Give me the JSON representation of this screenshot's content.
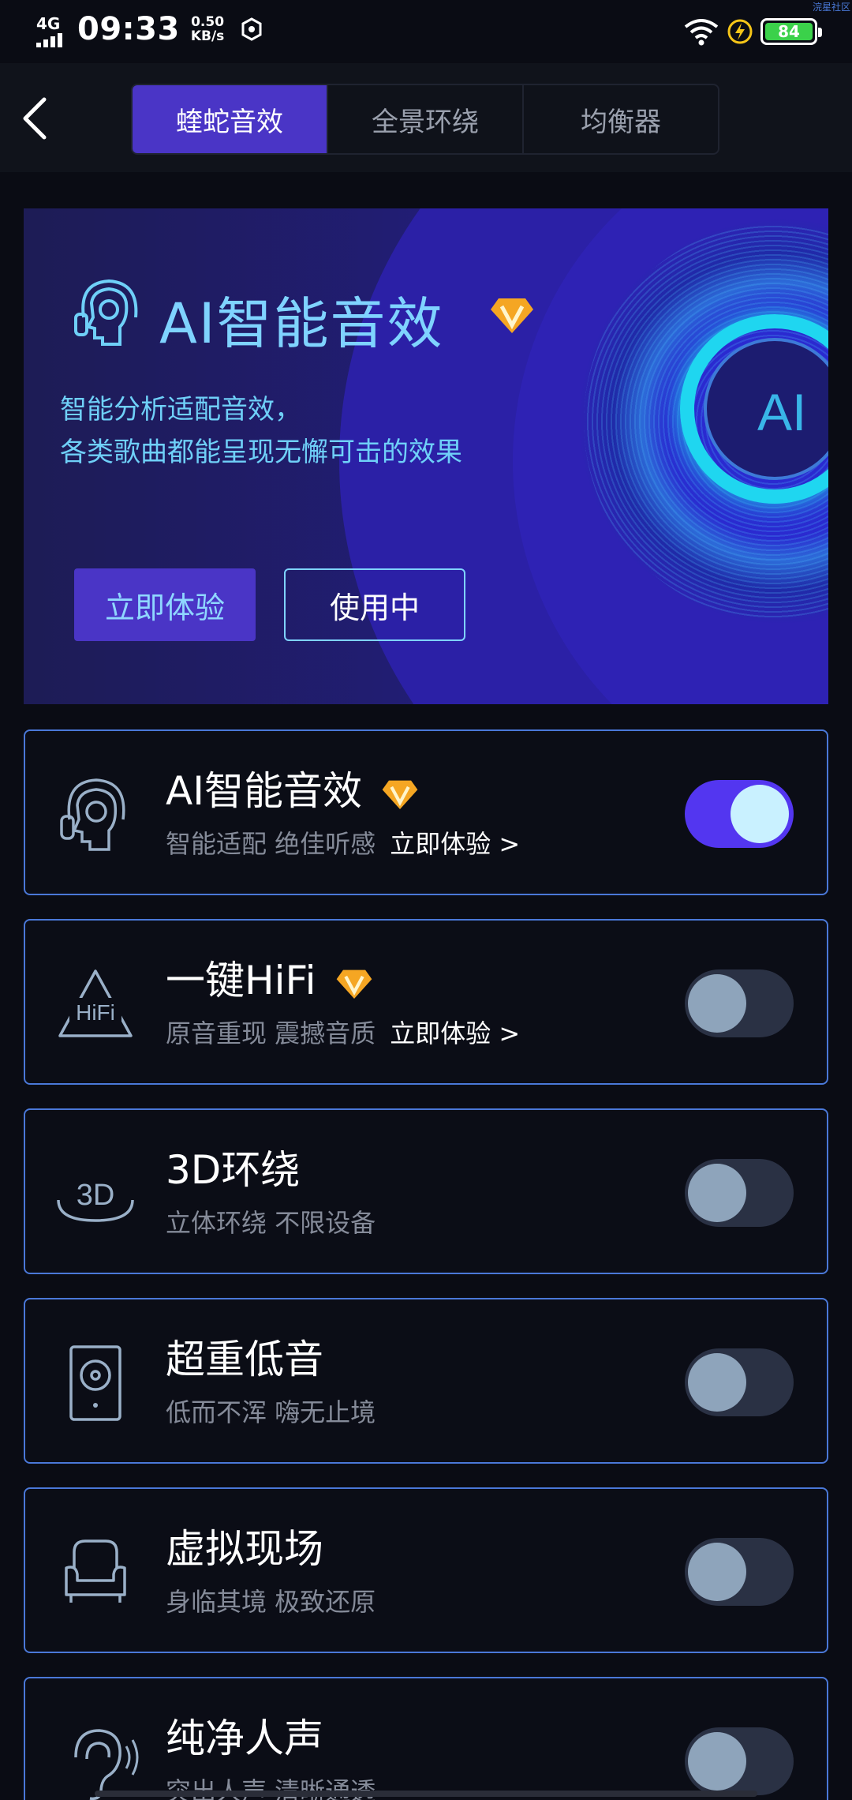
{
  "status_bar": {
    "network": "4G",
    "time": "09:33",
    "speed_value": "0.50",
    "speed_unit": "KB/s",
    "battery": "84",
    "watermark": "浣星社区"
  },
  "header": {
    "tabs": [
      {
        "label": "蝰蛇音效",
        "active": true
      },
      {
        "label": "全景环绕",
        "active": false
      },
      {
        "label": "均衡器",
        "active": false
      }
    ]
  },
  "banner": {
    "title": "AI智能音效",
    "desc_line1": "智能分析适配音效，",
    "desc_line2": "各类歌曲都能呈现无懈可击的效果",
    "try_label": "立即体验",
    "using_label": "使用中",
    "core_text": "AI"
  },
  "cards": [
    {
      "title": "AI智能音效",
      "sub": "智能适配 绝佳听感",
      "link": "立即体验 >",
      "vip": true,
      "on": true,
      "icon": "head-headphones-icon"
    },
    {
      "title": "一键HiFi",
      "sub": "原音重现 震撼音质",
      "link": "立即体验 >",
      "vip": true,
      "on": false,
      "icon": "hifi-icon"
    },
    {
      "title": "3D环绕",
      "sub": "立体环绕 不限设备",
      "on": false,
      "icon": "3d-surround-icon"
    },
    {
      "title": "超重低音",
      "sub": "低而不浑 嗨无止境",
      "on": false,
      "icon": "speaker-icon"
    },
    {
      "title": "虚拟现场",
      "sub": "身临其境 极致还原",
      "on": false,
      "icon": "armchair-icon"
    },
    {
      "title": "纯净人声",
      "sub": "突出人声 清晰通透",
      "on": false,
      "icon": "ear-icon"
    }
  ],
  "colors": {
    "accent": "#4a35c6",
    "toggle_on": "#5336f0",
    "card_border": "#4a78d8",
    "vip_gold": "#f5a623",
    "battery_green": "#3bd14a"
  }
}
